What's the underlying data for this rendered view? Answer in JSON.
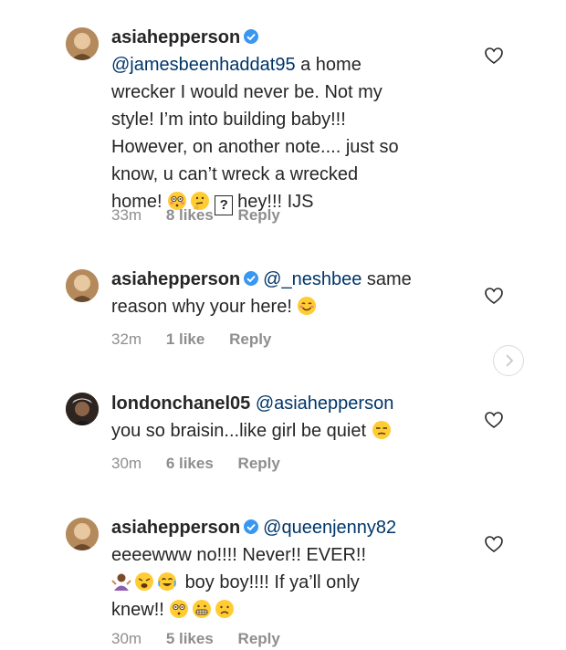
{
  "comments": [
    {
      "username": "asiahepperson",
      "verified": true,
      "mention": "@jamesbeenhaddat95",
      "text_lines": [
        " a home",
        "wrecker I would never be. Not my",
        "style! I’m into building baby!!!",
        "However, on another note.... just so",
        "know, u can’t wreck a wrecked",
        "home!"
      ],
      "tail_box_glyph": "?",
      "tail_text": "hey!!! IJS",
      "time": "33m",
      "likes": "8 likes",
      "reply": "Reply"
    },
    {
      "username": "asiahepperson",
      "verified": true,
      "mention": "@_neshbee",
      "text_lines": [
        " same",
        "reason why your here!"
      ],
      "time": "32m",
      "likes": "1 like",
      "reply": "Reply"
    },
    {
      "username": "londonchanel05",
      "verified": false,
      "mention": "@asiahepperson",
      "text_lines": [
        "you so braisin...like girl be quiet"
      ],
      "time": "30m",
      "likes": "6 likes",
      "reply": "Reply"
    },
    {
      "username": "asiahepperson",
      "verified": true,
      "mention": "@queenjenny82",
      "text_lines": [
        "eeeewww no!!!! Never!! EVER!!",
        "boy boy!!!! If ya’ll only",
        "knew!!"
      ],
      "time": "30m",
      "likes": "5 likes",
      "reply": "Reply"
    }
  ],
  "colors": {
    "text": "#262626",
    "mention": "#003569",
    "meta": "#8e8e8e",
    "verified": "#3897f0"
  },
  "icons": [
    "verified-badge-icon",
    "heart-outline-icon",
    "chevron-right-icon",
    "emoji-icon"
  ]
}
